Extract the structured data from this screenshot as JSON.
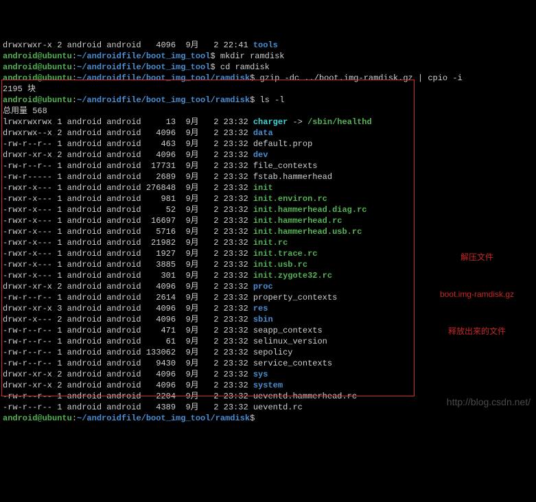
{
  "preamble": [
    {
      "perms": "drwxrwxr-x",
      "links": "2",
      "owner": "android",
      "group": "android",
      "size": "4096",
      "month": "9月",
      "day": "2",
      "time": "22:41",
      "name": "tools",
      "cls": "blue"
    }
  ],
  "prompts": [
    {
      "user": "android@ubuntu",
      "path": "~/androidfile/boot_img_tool",
      "cmd": "mkdir ramdisk"
    },
    {
      "user": "android@ubuntu",
      "path": "~/androidfile/boot_img_tool",
      "cmd": "cd ramdisk"
    },
    {
      "user": "android@ubuntu",
      "path": "~/androidfile/boot_img_tool/ramdisk",
      "cmd": "gzip -dc ../boot.img-ramdisk.gz | cpio -i"
    }
  ],
  "cpio_out": "2195 块",
  "prompt_ls": {
    "user": "android@ubuntu",
    "path": "~/androidfile/boot_img_tool/ramdisk",
    "cmd": "ls -l"
  },
  "total_line": "总用量 568",
  "rows": [
    {
      "perms": "lrwxrwxrwx",
      "links": "1",
      "owner": "android",
      "group": "android",
      "size": "13",
      "month": "9月",
      "day": "2",
      "time": "23:32",
      "name": "charger",
      "cls": "cyan",
      "arrow": "->",
      "target": "/sbin/healthd",
      "tcls": "green"
    },
    {
      "perms": "drwxrwx--x",
      "links": "2",
      "owner": "android",
      "group": "android",
      "size": "4096",
      "month": "9月",
      "day": "2",
      "time": "23:32",
      "name": "data",
      "cls": "blue"
    },
    {
      "perms": "-rw-r--r--",
      "links": "1",
      "owner": "android",
      "group": "android",
      "size": "463",
      "month": "9月",
      "day": "2",
      "time": "23:32",
      "name": "default.prop",
      "cls": "white"
    },
    {
      "perms": "drwxr-xr-x",
      "links": "2",
      "owner": "android",
      "group": "android",
      "size": "4096",
      "month": "9月",
      "day": "2",
      "time": "23:32",
      "name": "dev",
      "cls": "blue"
    },
    {
      "perms": "-rw-r--r--",
      "links": "1",
      "owner": "android",
      "group": "android",
      "size": "17731",
      "month": "9月",
      "day": "2",
      "time": "23:32",
      "name": "file_contexts",
      "cls": "white"
    },
    {
      "perms": "-rw-r-----",
      "links": "1",
      "owner": "android",
      "group": "android",
      "size": "2689",
      "month": "9月",
      "day": "2",
      "time": "23:32",
      "name": "fstab.hammerhead",
      "cls": "white"
    },
    {
      "perms": "-rwxr-x---",
      "links": "1",
      "owner": "android",
      "group": "android",
      "size": "276848",
      "month": "9月",
      "day": "2",
      "time": "23:32",
      "name": "init",
      "cls": "green"
    },
    {
      "perms": "-rwxr-x---",
      "links": "1",
      "owner": "android",
      "group": "android",
      "size": "981",
      "month": "9月",
      "day": "2",
      "time": "23:32",
      "name": "init.environ.rc",
      "cls": "green"
    },
    {
      "perms": "-rwxr-x---",
      "links": "1",
      "owner": "android",
      "group": "android",
      "size": "52",
      "month": "9月",
      "day": "2",
      "time": "23:32",
      "name": "init.hammerhead.diag.rc",
      "cls": "green"
    },
    {
      "perms": "-rwxr-x---",
      "links": "1",
      "owner": "android",
      "group": "android",
      "size": "16697",
      "month": "9月",
      "day": "2",
      "time": "23:32",
      "name": "init.hammerhead.rc",
      "cls": "green"
    },
    {
      "perms": "-rwxr-x---",
      "links": "1",
      "owner": "android",
      "group": "android",
      "size": "5716",
      "month": "9月",
      "day": "2",
      "time": "23:32",
      "name": "init.hammerhead.usb.rc",
      "cls": "green"
    },
    {
      "perms": "-rwxr-x---",
      "links": "1",
      "owner": "android",
      "group": "android",
      "size": "21982",
      "month": "9月",
      "day": "2",
      "time": "23:32",
      "name": "init.rc",
      "cls": "green"
    },
    {
      "perms": "-rwxr-x---",
      "links": "1",
      "owner": "android",
      "group": "android",
      "size": "1927",
      "month": "9月",
      "day": "2",
      "time": "23:32",
      "name": "init.trace.rc",
      "cls": "green"
    },
    {
      "perms": "-rwxr-x---",
      "links": "1",
      "owner": "android",
      "group": "android",
      "size": "3885",
      "month": "9月",
      "day": "2",
      "time": "23:32",
      "name": "init.usb.rc",
      "cls": "green"
    },
    {
      "perms": "-rwxr-x---",
      "links": "1",
      "owner": "android",
      "group": "android",
      "size": "301",
      "month": "9月",
      "day": "2",
      "time": "23:32",
      "name": "init.zygote32.rc",
      "cls": "green"
    },
    {
      "perms": "drwxr-xr-x",
      "links": "2",
      "owner": "android",
      "group": "android",
      "size": "4096",
      "month": "9月",
      "day": "2",
      "time": "23:32",
      "name": "proc",
      "cls": "blue"
    },
    {
      "perms": "-rw-r--r--",
      "links": "1",
      "owner": "android",
      "group": "android",
      "size": "2614",
      "month": "9月",
      "day": "2",
      "time": "23:32",
      "name": "property_contexts",
      "cls": "white"
    },
    {
      "perms": "drwxr-xr-x",
      "links": "3",
      "owner": "android",
      "group": "android",
      "size": "4096",
      "month": "9月",
      "day": "2",
      "time": "23:32",
      "name": "res",
      "cls": "blue"
    },
    {
      "perms": "drwxr-x---",
      "links": "2",
      "owner": "android",
      "group": "android",
      "size": "4096",
      "month": "9月",
      "day": "2",
      "time": "23:32",
      "name": "sbin",
      "cls": "blue"
    },
    {
      "perms": "-rw-r--r--",
      "links": "1",
      "owner": "android",
      "group": "android",
      "size": "471",
      "month": "9月",
      "day": "2",
      "time": "23:32",
      "name": "seapp_contexts",
      "cls": "white"
    },
    {
      "perms": "-rw-r--r--",
      "links": "1",
      "owner": "android",
      "group": "android",
      "size": "61",
      "month": "9月",
      "day": "2",
      "time": "23:32",
      "name": "selinux_version",
      "cls": "white"
    },
    {
      "perms": "-rw-r--r--",
      "links": "1",
      "owner": "android",
      "group": "android",
      "size": "133062",
      "month": "9月",
      "day": "2",
      "time": "23:32",
      "name": "sepolicy",
      "cls": "white"
    },
    {
      "perms": "-rw-r--r--",
      "links": "1",
      "owner": "android",
      "group": "android",
      "size": "9430",
      "month": "9月",
      "day": "2",
      "time": "23:32",
      "name": "service_contexts",
      "cls": "white"
    },
    {
      "perms": "drwxr-xr-x",
      "links": "2",
      "owner": "android",
      "group": "android",
      "size": "4096",
      "month": "9月",
      "day": "2",
      "time": "23:32",
      "name": "sys",
      "cls": "blue"
    },
    {
      "perms": "drwxr-xr-x",
      "links": "2",
      "owner": "android",
      "group": "android",
      "size": "4096",
      "month": "9月",
      "day": "2",
      "time": "23:32",
      "name": "system",
      "cls": "blue"
    },
    {
      "perms": "-rw-r--r--",
      "links": "1",
      "owner": "android",
      "group": "android",
      "size": "2204",
      "month": "9月",
      "day": "2",
      "time": "23:32",
      "name": "ueventd.hammerhead.rc",
      "cls": "white"
    },
    {
      "perms": "-rw-r--r--",
      "links": "1",
      "owner": "android",
      "group": "android",
      "size": "4389",
      "month": "9月",
      "day": "2",
      "time": "23:32",
      "name": "ueventd.rc",
      "cls": "white"
    }
  ],
  "prompt_tail": {
    "user": "android@ubuntu",
    "path": "~/androidfile/boot_img_tool/ramdisk",
    "cmd": ""
  },
  "annotation": {
    "l1": "解压文件",
    "l2": "boot.img-ramdisk.gz",
    "l3": "释放出来的文件"
  },
  "watermark": "http://blog.csdn.net/"
}
